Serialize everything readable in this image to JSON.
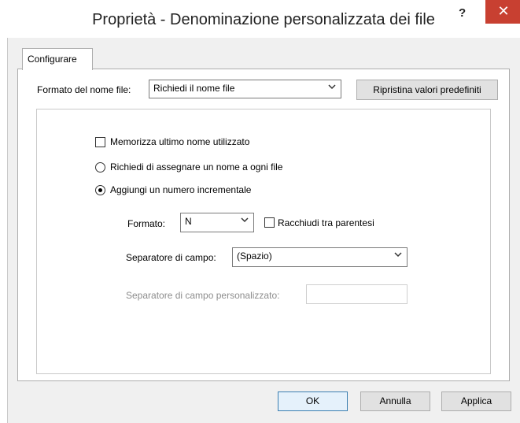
{
  "window": {
    "title": "Proprietà - Denominazione personalizzata dei file",
    "help_label": "?",
    "close_label": "✕"
  },
  "tabs": [
    {
      "label": "Configurare"
    }
  ],
  "format": {
    "label": "Formato del nome file:",
    "selected": "Richiedi il nome file",
    "reset_button": "Ripristina valori predefiniti"
  },
  "options": {
    "remember": {
      "label": "Memorizza ultimo nome utilizzato",
      "checked": false
    },
    "ask_each": {
      "label": "Richiedi di assegnare un nome a ogni file",
      "selected": false
    },
    "incremental": {
      "label": "Aggiungi un numero incrementale",
      "selected": true
    }
  },
  "incremental": {
    "format_label": "Formato:",
    "format_value": "N",
    "brackets_label": "Racchiudi tra parentesi",
    "brackets_checked": false,
    "separator_label": "Separatore di campo:",
    "separator_value": "(Spazio)",
    "custom_separator_label": "Separatore di campo personalizzato:",
    "custom_separator_value": ""
  },
  "buttons": {
    "ok": "OK",
    "cancel": "Annulla",
    "apply": "Applica"
  },
  "colors": {
    "close_button": "#c84031",
    "dialog_bg": "#f0f0f0",
    "default_button_border": "#3c7fb1"
  }
}
